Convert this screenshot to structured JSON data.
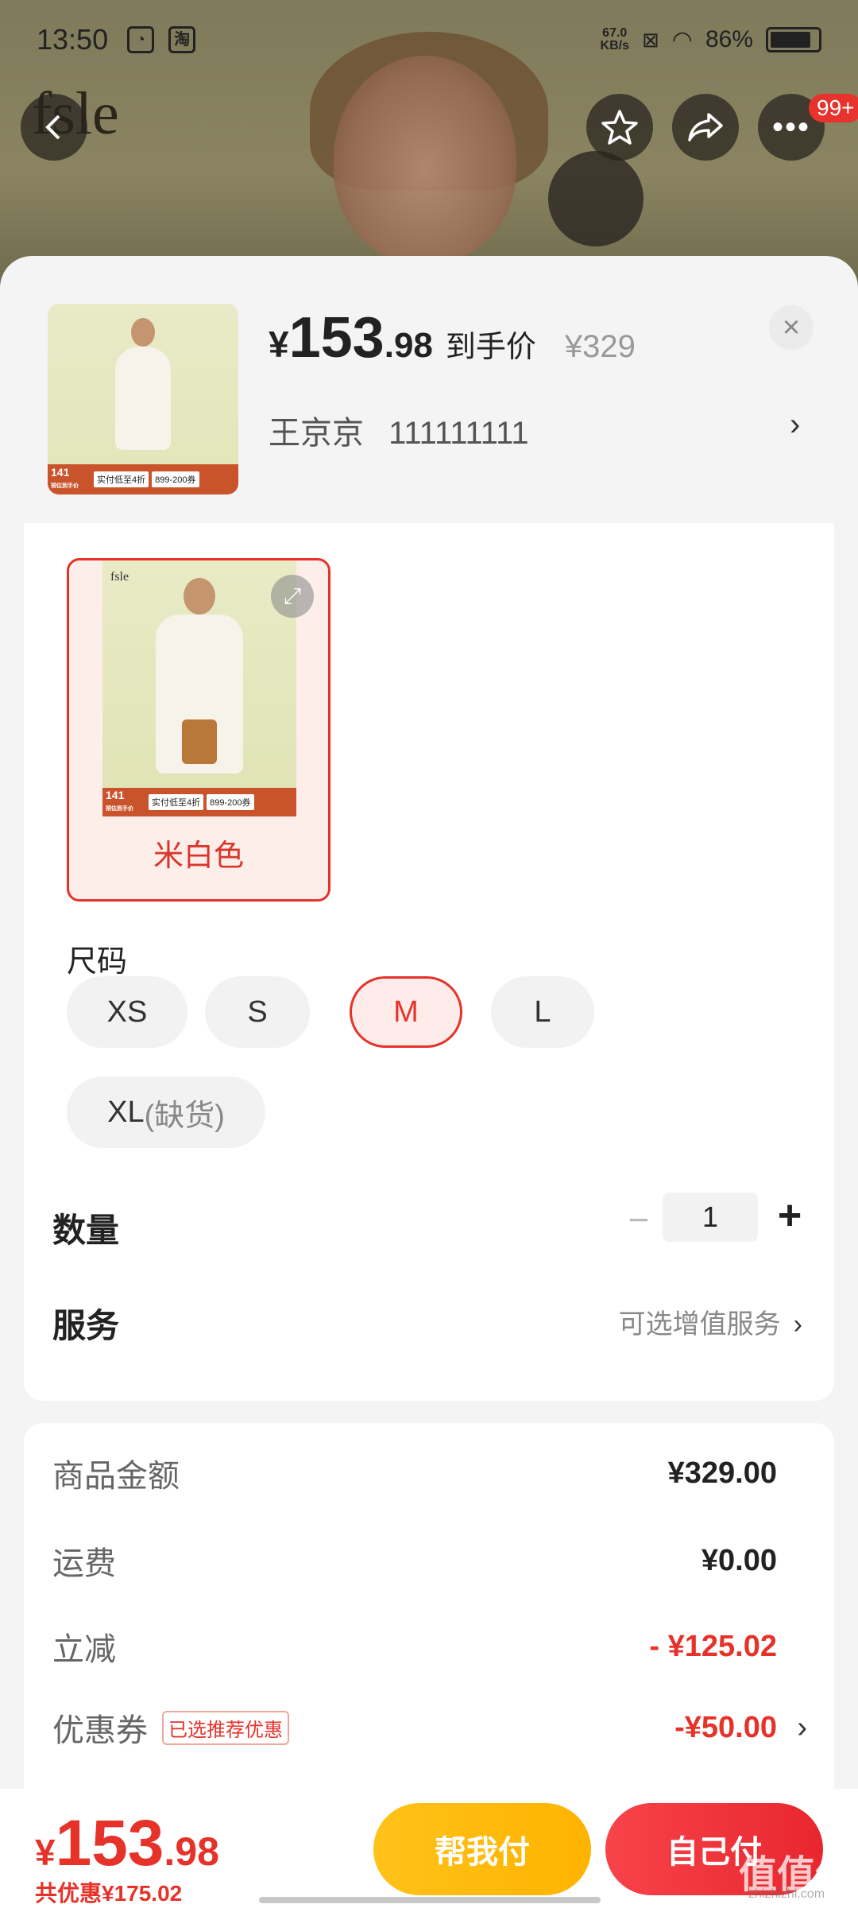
{
  "status_bar": {
    "time": "13:50",
    "app_icon_1": "qq-icon",
    "app_icon_2": "淘",
    "net_speed_value": "67.0",
    "net_speed_unit": "KB/s",
    "battery": "86%",
    "battery_level": 0.86
  },
  "hero": {
    "brand": "fsle",
    "badge": "99+"
  },
  "product": {
    "price_symbol": "¥",
    "price_int": "153",
    "price_dec": ".98",
    "price_label": "到手价",
    "original_price": "¥329",
    "address_name": "王京京",
    "address_phone": "111111111",
    "thumb_promo_num": "141",
    "thumb_promo_sub": "预估到手价",
    "thumb_promo_text": "实付低至4折",
    "thumb_coupon": "899-200券"
  },
  "color_option": {
    "label": "米白色",
    "brand": "fsle",
    "promo_num": "141",
    "promo_sub": "预估到手价",
    "promo_text": "实付低至4折",
    "coupon": "899-200券"
  },
  "size": {
    "title": "尺码",
    "options": [
      "XS",
      "S",
      "M",
      "L",
      "XL"
    ],
    "selected": "M",
    "out_of_stock_suffix": "(缺货)"
  },
  "quantity": {
    "label": "数量",
    "value": "1",
    "minus": "−",
    "plus": "+"
  },
  "service": {
    "label": "服务",
    "value": "可选增值服务"
  },
  "summary": {
    "goods_label": "商品金额",
    "goods_value": "¥329.00",
    "shipping_label": "运费",
    "shipping_value": "¥0.00",
    "discount_label": "立减",
    "discount_value": "- ¥125.02",
    "coupon_label": "优惠券",
    "coupon_tag": "已选推荐优惠",
    "coupon_value": "-¥50.00"
  },
  "bottom": {
    "total_symbol": "¥",
    "total_int": "153",
    "total_dec": ".98",
    "total_discount": "共优惠¥175.02",
    "help_pay": "帮我付",
    "self_pay": "自己付"
  },
  "watermark": {
    "main": "值值值",
    "sub": "zhizhizhi.com"
  },
  "colors": {
    "accent_red": "#e6332a",
    "accent_yellow": "#ffc21a"
  }
}
